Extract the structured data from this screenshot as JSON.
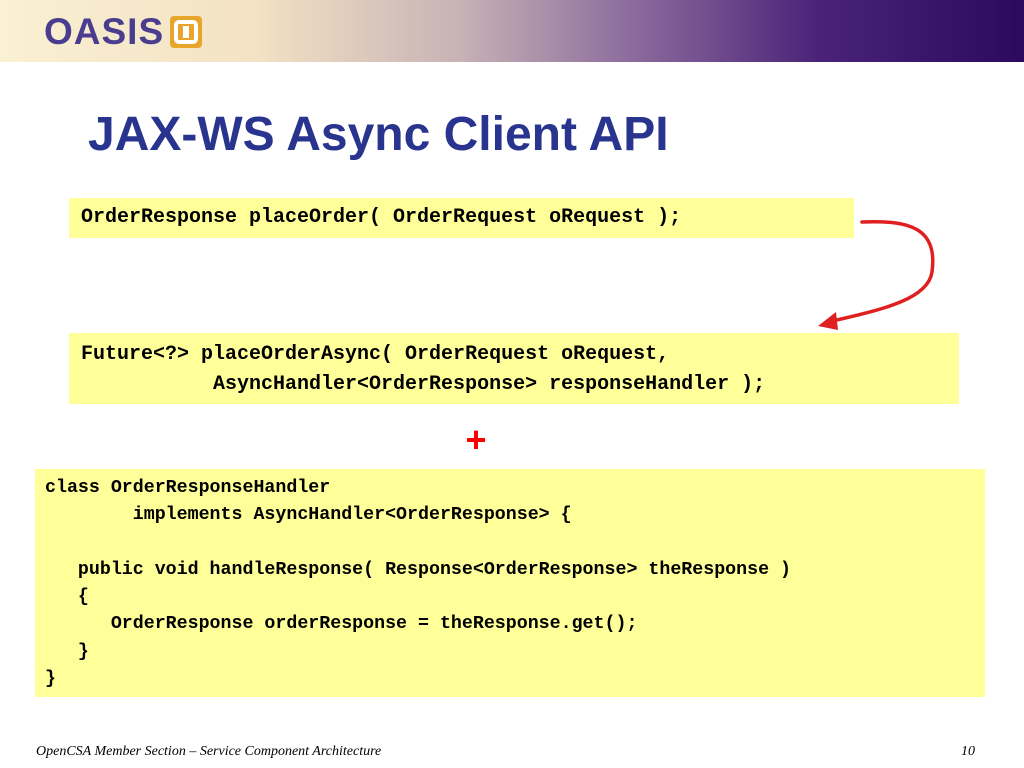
{
  "header": {
    "logo_text": "OASIS",
    "logo_icon": "oasis-mark-icon"
  },
  "slide": {
    "title": "JAX-WS Async Client API",
    "sync_signature": "OrderResponse placeOrder( OrderRequest oRequest );",
    "async_signature_lines": [
      "Future<?> placeOrderAsync( OrderRequest oRequest,",
      "           AsyncHandler<OrderResponse> responseHandler );"
    ],
    "plus_symbol": "+",
    "handler_code_lines": [
      "class OrderResponseHandler",
      "        implements AsyncHandler<OrderResponse> {",
      "",
      "   public void handleResponse( Response<OrderResponse> theResponse )",
      "   {",
      "      OrderResponse orderResponse = theResponse.get();",
      "   }",
      "}"
    ],
    "arrow_icon": "curved-arrow-icon"
  },
  "footer": {
    "left_text": "OpenCSA Member Section – Service Component Architecture",
    "page_number": "10"
  },
  "colors": {
    "title": "#29348f",
    "logo": "#4a3c8e",
    "logo_accent": "#e8a52c",
    "code_background": "#ffff99",
    "arrow": "#e02020",
    "plus": "#ff0000"
  }
}
